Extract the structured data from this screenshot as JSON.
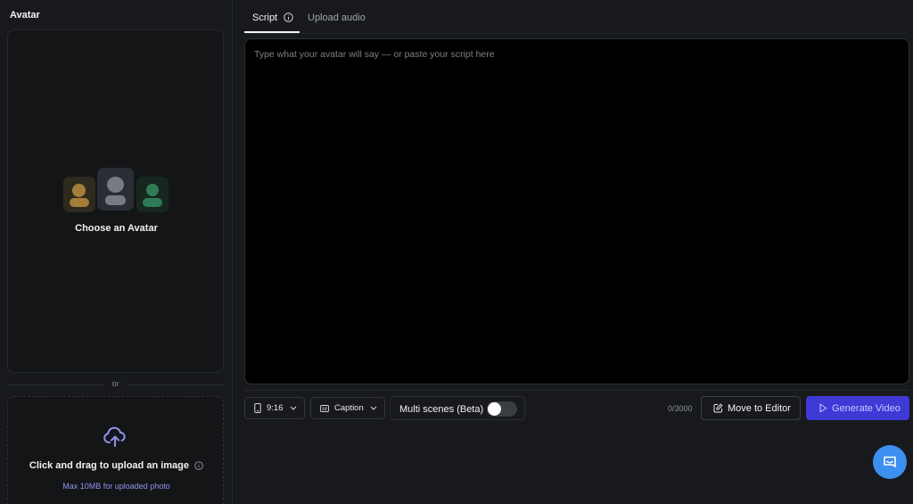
{
  "sidebar": {
    "title": "Avatar",
    "choose_label": "Choose an Avatar",
    "or_text": "or",
    "upload_label": "Click and drag to upload an image",
    "upload_sub": "Max 10MB for uploaded photo"
  },
  "tabs": [
    {
      "label": "Script",
      "active": true
    },
    {
      "label": "Upload audio",
      "active": false
    }
  ],
  "script": {
    "placeholder": "Type what your avatar will say — or paste your script here",
    "value": ""
  },
  "toolbar": {
    "aspect_ratio": "9:16",
    "caption_label": "Caption",
    "multi_scenes_label": "Multi scenes (Beta)",
    "multi_scenes_enabled": false,
    "char_count": "0/3000",
    "move_to_editor_label": "Move to Editor",
    "generate_label": "Generate Video"
  },
  "colors": {
    "accent": "#3f39d6",
    "chat_bubble": "#3d8ff0",
    "upload_icon": "#8f93f0"
  },
  "icons": [
    "info-icon",
    "upload-cloud-icon",
    "phone-icon",
    "caption-icon",
    "chevron-down-icon",
    "edit-icon",
    "play-icon",
    "chat-icon"
  ]
}
